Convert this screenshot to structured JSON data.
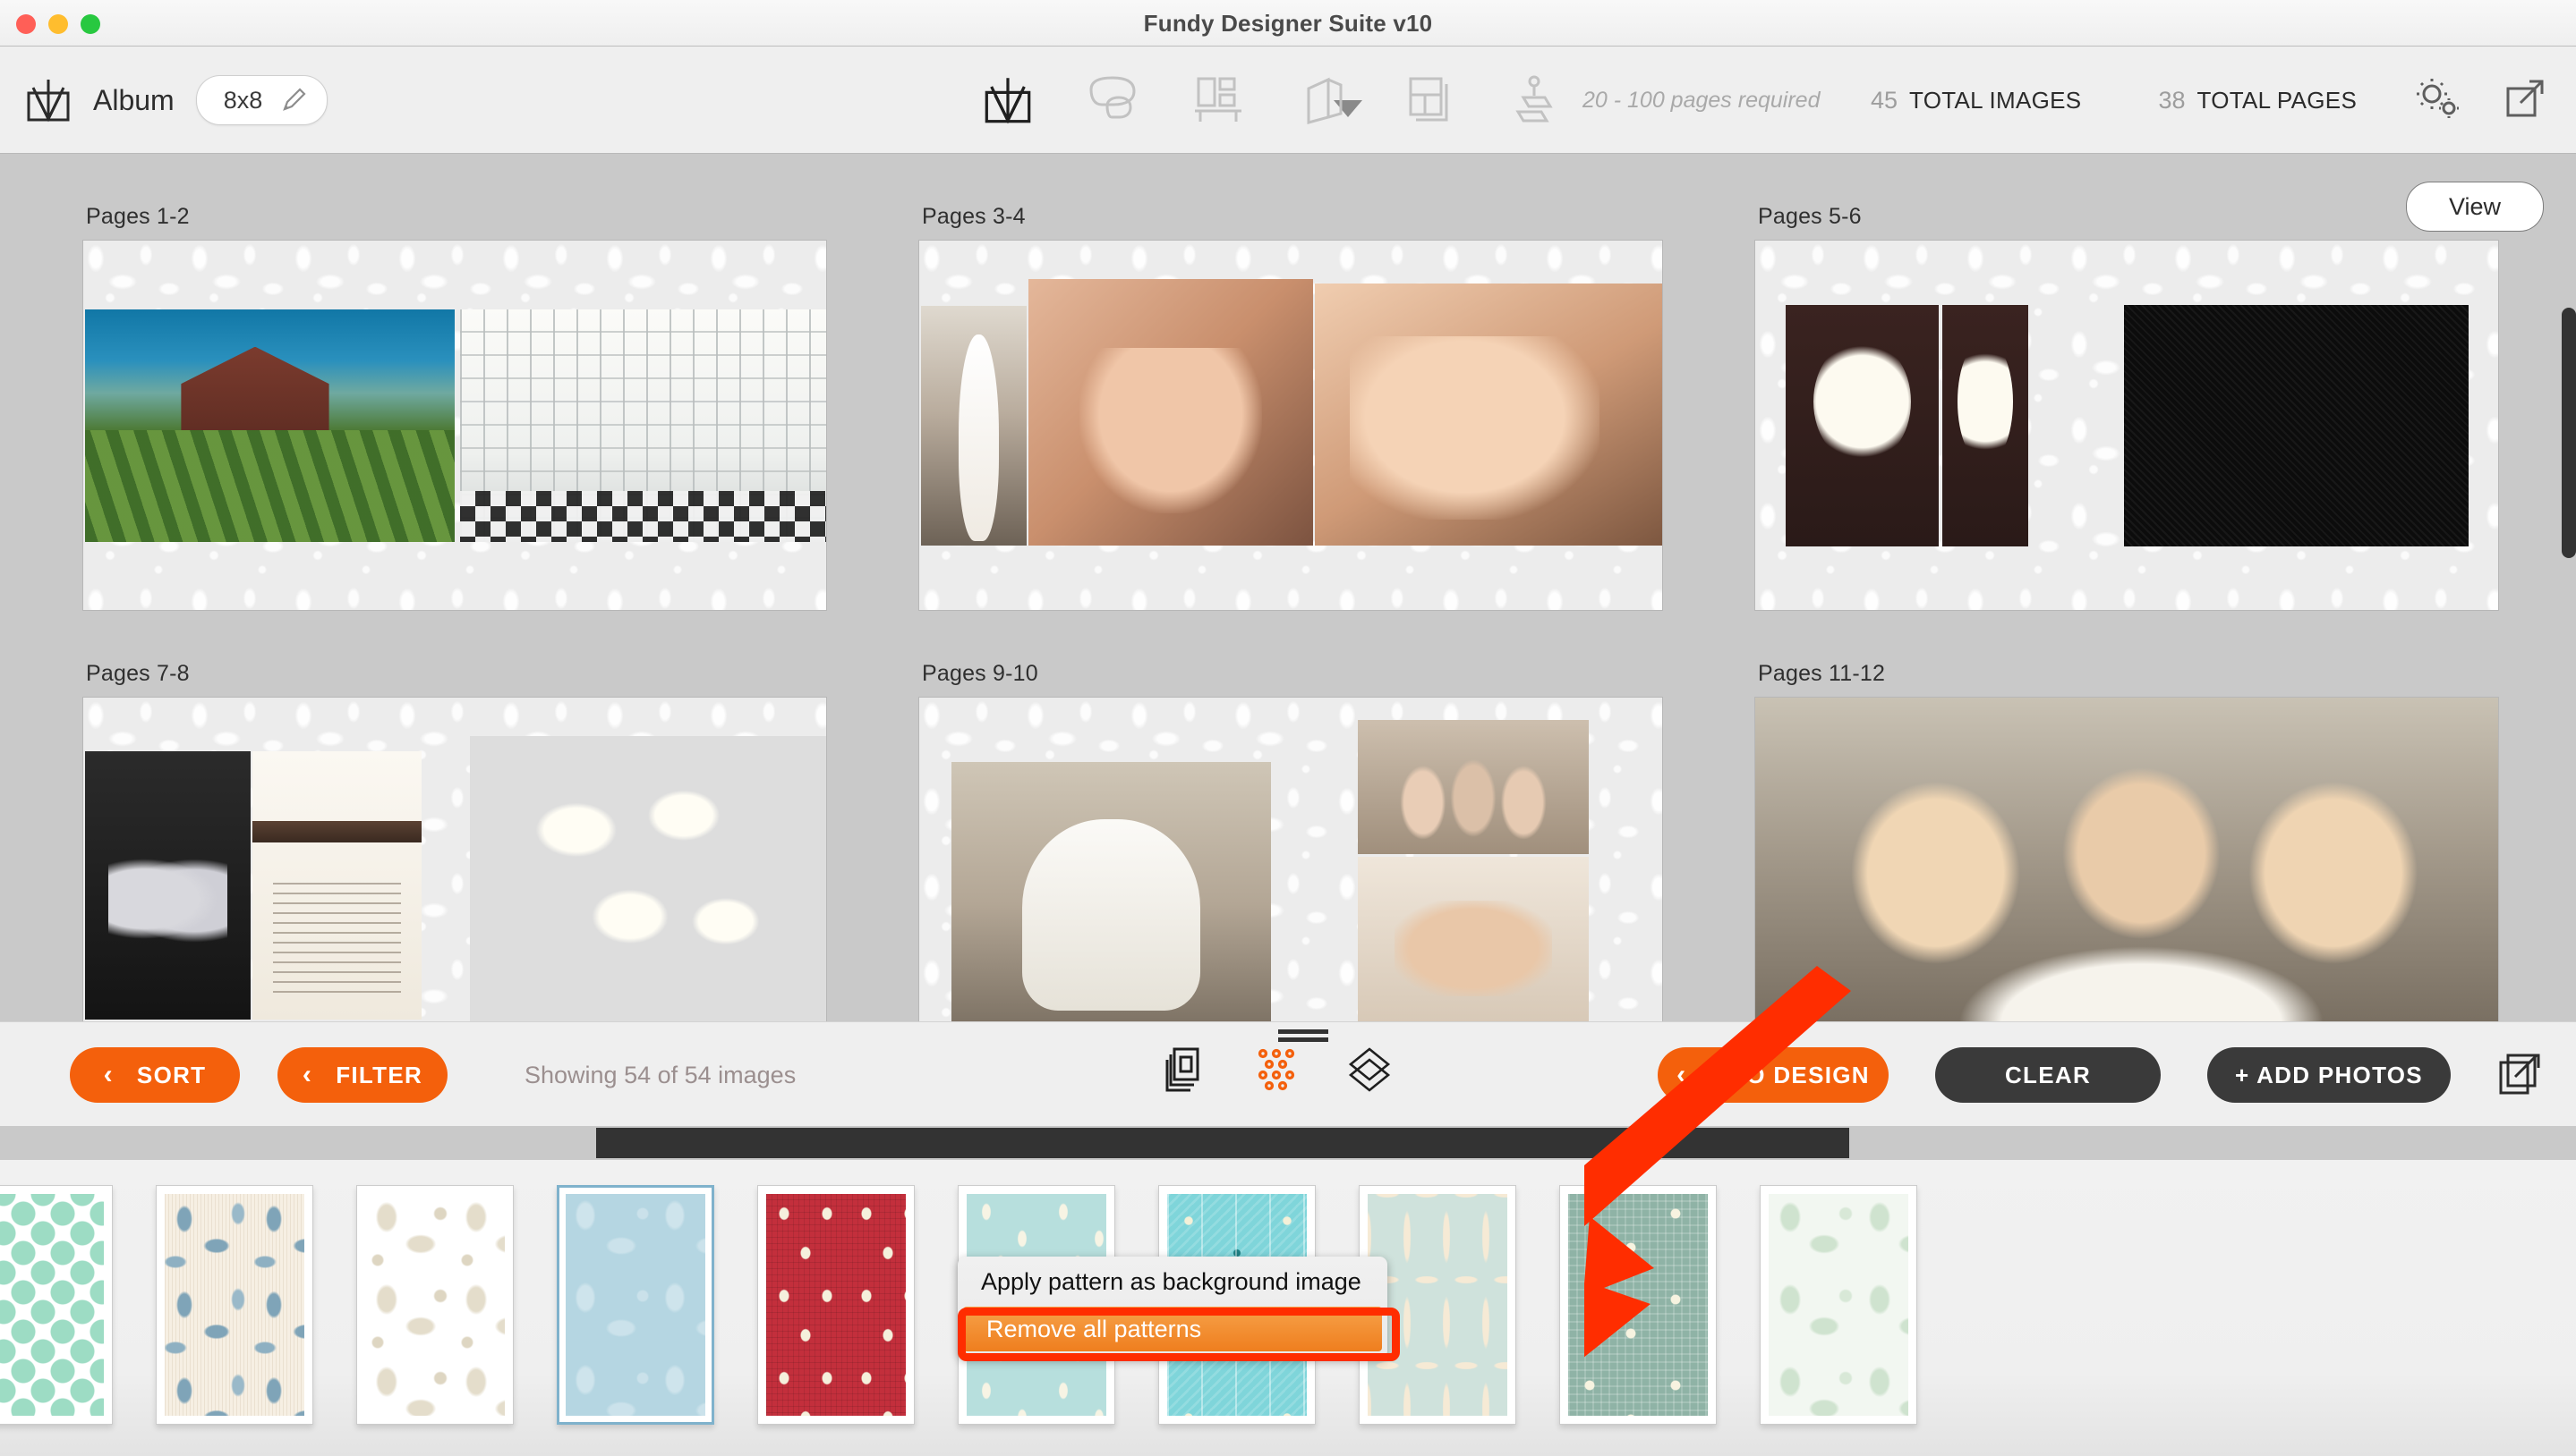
{
  "window": {
    "title": "Fundy Designer Suite v10",
    "controls": [
      "close",
      "minimize",
      "zoom"
    ]
  },
  "toolbar": {
    "album_label": "Album",
    "size_value": "8x8",
    "edit_icon": "pencil-icon",
    "tools": [
      {
        "name": "album-tool",
        "icon": "album-icon",
        "active": true
      },
      {
        "name": "comments-tool",
        "icon": "speech-bubble-icon",
        "active": false
      },
      {
        "name": "wall-art-tool",
        "icon": "wall-display-icon",
        "active": false
      },
      {
        "name": "cards-tool",
        "icon": "folded-card-icon",
        "active": false
      },
      {
        "name": "layout-tool",
        "icon": "page-layout-icon",
        "active": false
      },
      {
        "name": "proof-tool",
        "icon": "stamp-icon",
        "active": false
      }
    ],
    "pages_required": "20 - 100 pages required",
    "stats": [
      {
        "num": "45",
        "label": "TOTAL IMAGES"
      },
      {
        "num": "38",
        "label": "TOTAL PAGES"
      }
    ],
    "right_icons": [
      {
        "name": "settings-gears-icon"
      },
      {
        "name": "expand-external-icon"
      }
    ]
  },
  "canvas": {
    "view_button": "View",
    "spreads": [
      {
        "caption": "Pages 1-2",
        "art": [
          "p-garden",
          "p-window"
        ]
      },
      {
        "caption": "Pages 3-4",
        "art": [
          "p-dressroom",
          "p-bride",
          "p-bride2"
        ]
      },
      {
        "caption": "Pages 5-6",
        "art": [
          "p-bouquetdark",
          "p-bouquetdark",
          "p-black"
        ]
      },
      {
        "caption": "Pages 7-8",
        "art": [
          "p-shoes",
          "p-invite",
          "p-wheat"
        ]
      },
      {
        "caption": "Pages 9-10",
        "art": [
          "p-robe",
          "p-maids",
          "p-hands"
        ]
      },
      {
        "caption": "Pages 11-12",
        "art": [
          "p-threegirls"
        ]
      }
    ]
  },
  "photobar": {
    "sort_label": "SORT",
    "filter_label": "FILTER",
    "chevron": "‹",
    "showing_text": "Showing 54 of 54 images",
    "view_mode_icons": [
      {
        "name": "stacked-photos-icon",
        "active": false
      },
      {
        "name": "dot-grid-icon",
        "active": true
      },
      {
        "name": "layers-diamond-icon",
        "active": false
      }
    ],
    "grip": "drag-handle",
    "auto_design_label": "AUTO DESIGN",
    "clear_label": "CLEAR",
    "add_photos_label": "+ ADD PHOTOS",
    "export_icon": "export-photos-icon"
  },
  "tray": {
    "swatches": [
      {
        "name": "mint-lattice",
        "class": "sw-lattice",
        "selected": false
      },
      {
        "name": "blue-floral-vine",
        "class": "sw-bluefloral",
        "selected": false
      },
      {
        "name": "cream-damask",
        "class": "sw-creamdamask",
        "selected": false
      },
      {
        "name": "blue-flock-damask",
        "class": "sw-blueflock",
        "selected": true
      },
      {
        "name": "red-polka-linen",
        "class": "sw-reddot",
        "selected": false
      },
      {
        "name": "aqua-raindrops",
        "class": "sw-raindrop",
        "selected": false
      },
      {
        "name": "teal-gift-chevron",
        "class": "sw-gifts",
        "selected": false
      },
      {
        "name": "mint-ogee",
        "class": "sw-ogee",
        "selected": false
      },
      {
        "name": "sage-hearts-plaid",
        "class": "sw-hearts",
        "selected": false
      },
      {
        "name": "mint-damask",
        "class": "sw-mintdamask",
        "selected": false
      }
    ]
  },
  "context_menu": {
    "items": [
      {
        "label": "Apply pattern as background image",
        "highlighted": false
      },
      {
        "label": "Remove all patterns",
        "highlighted": true
      }
    ]
  },
  "colors": {
    "accent_orange": "#f4600c",
    "dark_button": "#3a3a3a",
    "annotation_red": "#ff2d00",
    "canvas_gray": "#c9c9c9",
    "chrome_gray": "#efefef"
  }
}
